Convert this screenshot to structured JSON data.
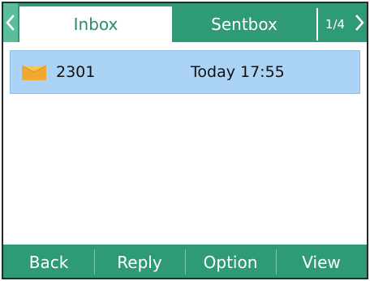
{
  "tabs": [
    {
      "label": "Inbox",
      "active": true
    },
    {
      "label": "Sentbox",
      "active": false
    }
  ],
  "page_indicator": "1/4",
  "messages": [
    {
      "sender": "2301",
      "time": "Today 17:55",
      "icon": "envelope-icon",
      "selected": true
    }
  ],
  "softkeys": {
    "back": "Back",
    "reply": "Reply",
    "option": "Option",
    "view": "View"
  },
  "colors": {
    "accent": "#2e9a78",
    "accent_light": "#5bbd9b",
    "selection": "#abd3f5",
    "envelope": "#f0a830"
  }
}
